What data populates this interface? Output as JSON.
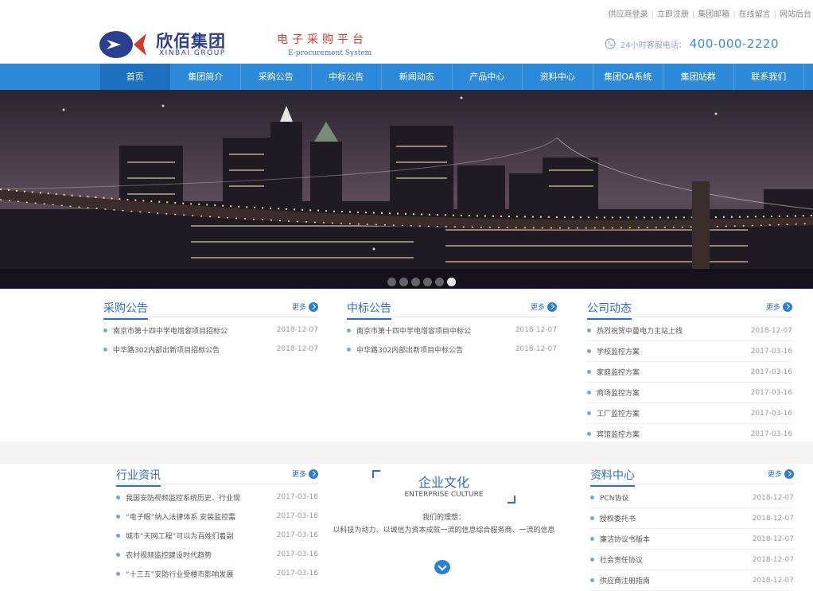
{
  "toplinks": [
    "供应商登录",
    "立即注册",
    "集团邮箱",
    "在线留言",
    "网站后台"
  ],
  "brand": {
    "name_cn": "欣佰集团",
    "name_en": "XINBAI GROUP",
    "slogan_cn": "电子采购平台",
    "slogan_en": "E-procurement System",
    "hotline_label": "24小时客服电话：",
    "hotline_number": "400-000-2220",
    "colors": {
      "primary": "#2d8ad9",
      "logo_blue": "#2b3f8f",
      "logo_red": "#d23a2a"
    }
  },
  "nav": [
    {
      "label": "首页",
      "active": true
    },
    {
      "label": "集团简介"
    },
    {
      "label": "采购公告"
    },
    {
      "label": "中标公告"
    },
    {
      "label": "新闻动态"
    },
    {
      "label": "产品中心"
    },
    {
      "label": "资料中心"
    },
    {
      "label": "集团OA系统"
    },
    {
      "label": "集团站群"
    },
    {
      "label": "联系我们"
    }
  ],
  "banner": {
    "slides": 6,
    "active_slide": 5
  },
  "more_label": "更多",
  "procurement": {
    "title": "采购公告",
    "items": [
      {
        "title": "南京市第十四中学电增容项目招标公",
        "date": "2018-12-07"
      },
      {
        "title": "中华路302内部出新项目招标公告",
        "date": "2018-12-07"
      }
    ]
  },
  "bidding": {
    "title": "中标公告",
    "items": [
      {
        "title": "南京市第十四中学电增容项目中标公",
        "date": "2018-12-07"
      },
      {
        "title": "中华路302内部出新项目中标公告",
        "date": "2018-12-07"
      }
    ]
  },
  "company_news": {
    "title": "公司动态",
    "items": [
      {
        "title": "热烈祝贺中曼电力主站上线",
        "date": "2018-12-07"
      },
      {
        "title": "学校监控方案",
        "date": "2017-03-16"
      },
      {
        "title": "家庭监控方案",
        "date": "2017-03-16"
      },
      {
        "title": "商场监控方案",
        "date": "2017-03-16"
      },
      {
        "title": "工厂监控方案",
        "date": "2017-03-16"
      },
      {
        "title": "宾馆监控方案",
        "date": "2017-03-16"
      }
    ]
  },
  "industry": {
    "title": "行业资讯",
    "items": [
      {
        "title": "我国安防视频监控系统历史、行业现",
        "date": "2017-03-16"
      },
      {
        "title": "“电子眼”纳入法律体系 安装监控需",
        "date": "2017-03-16"
      },
      {
        "title": "城市“天网工程”可以为百姓们着副",
        "date": "2017-03-16"
      },
      {
        "title": "农村视频监控建设时代趋势",
        "date": "2017-03-16"
      },
      {
        "title": "“十三五”安防行业受楼市影响发展",
        "date": "2017-03-16"
      }
    ]
  },
  "culture": {
    "title_cn": "企业文化",
    "title_en": "ENTERPRISE CULTURE",
    "line1": "我们的理想：",
    "line2": "以科技为动力、以诚信为资本成就一流的信息综合服务商、一流的信息"
  },
  "resources": {
    "title": "资料中心",
    "items": [
      {
        "title": "PCN协议",
        "date": "2018-12-07"
      },
      {
        "title": "授权委托书",
        "date": "2018-12-07"
      },
      {
        "title": "廉洁协议书版本",
        "date": "2018-12-07"
      },
      {
        "title": "社会责任协议",
        "date": "2018-12-07"
      },
      {
        "title": "供应商注册指南",
        "date": "2018-12-07"
      }
    ]
  }
}
